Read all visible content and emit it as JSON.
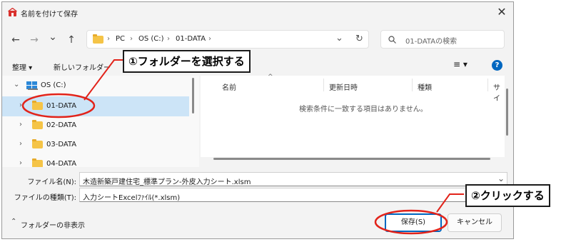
{
  "window": {
    "title": "名前を付けて保存",
    "close_glyph": "✕",
    "icon_color": "#d9302c"
  },
  "nav": {
    "back_glyph": "←",
    "forward_glyph": "→",
    "recent_glyph": "⌄",
    "up_glyph": "↑",
    "refresh_glyph": "↻",
    "chevron_glyph": "⌄",
    "breadcrumb": [
      "PC",
      "OS (C:)",
      "01-DATA"
    ],
    "separator": "›",
    "search_placeholder": "01-DATAの検索"
  },
  "toolbar": {
    "organize_label": "整理 ▾",
    "new_folder_label": "新しいフォルダー",
    "view_glyph": "≡ ▾",
    "help_glyph": "?"
  },
  "tree": {
    "root_label": "OS (C:)",
    "items": [
      {
        "label": "01-DATA",
        "selected": true
      },
      {
        "label": "02-DATA",
        "selected": false
      },
      {
        "label": "03-DATA",
        "selected": false
      },
      {
        "label": "04-DATA",
        "selected": false
      }
    ]
  },
  "columns": {
    "name": "名前",
    "modified": "更新日時",
    "type": "種類",
    "size": "サイ",
    "sort_glyph": "^"
  },
  "empty_message": "検索条件に一致する項目はありません。",
  "form": {
    "filename_label": "ファイル名(N):",
    "filename_value": "木造新築戸建住宅_標準プラン-外皮入力シート.xlsm",
    "filetype_label": "ファイルの種類(T):",
    "filetype_value": "入力シートExcelﾌｧｲﾙ(*.xlsm)",
    "dropdown_glyph": "⌄"
  },
  "footer": {
    "hide_folders_label": "フォルダーの非表示",
    "hide_glyph": "⌃",
    "save_label": "保存(S)",
    "cancel_label": "キャンセル"
  },
  "annotations": {
    "step1": "①フォルダーを選択する",
    "step2": "②クリックする",
    "highlight_color": "#e2231a"
  },
  "colors": {
    "accent": "#0067c0",
    "selection": "#cce4f7",
    "folder": "#f5c447"
  }
}
